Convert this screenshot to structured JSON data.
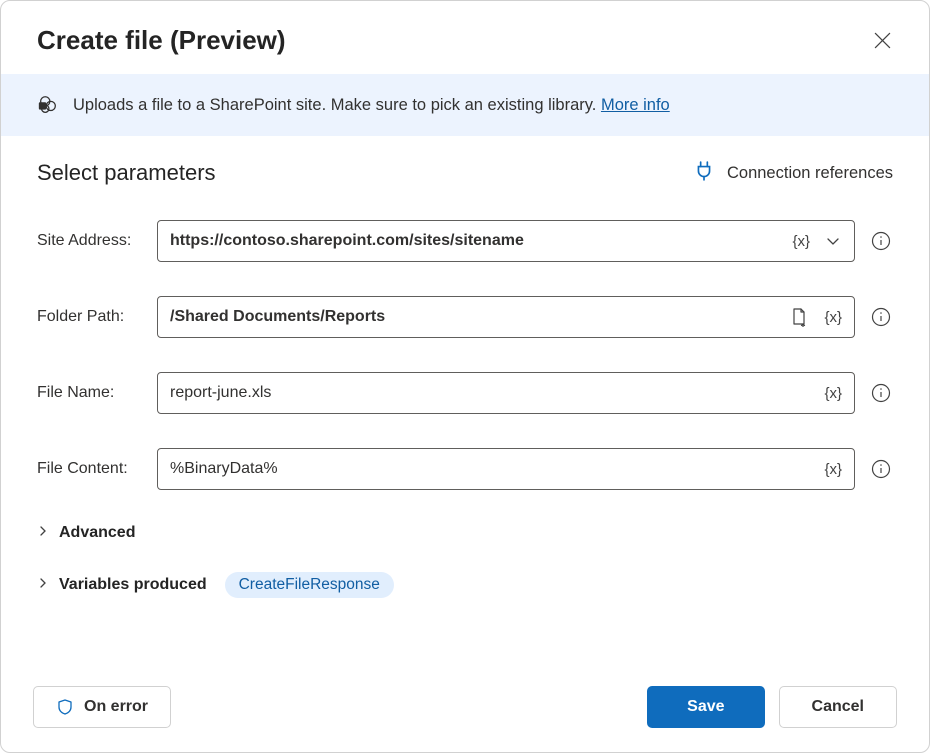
{
  "header": {
    "title": "Create file (Preview)"
  },
  "banner": {
    "text": "Uploads a file to a SharePoint site. Make sure to pick an existing library. ",
    "link_text": "More info"
  },
  "params": {
    "section_title": "Select parameters",
    "connection_references": "Connection references",
    "var_token": "{x}",
    "fields": {
      "site_address": {
        "label": "Site Address:",
        "value": "https://contoso.sharepoint.com/sites/sitename"
      },
      "folder_path": {
        "label": "Folder Path:",
        "value": "/Shared Documents/Reports"
      },
      "file_name": {
        "label": "File Name:",
        "value": "report-june.xls"
      },
      "file_content": {
        "label": "File Content:",
        "value": "%BinaryData%"
      }
    },
    "advanced_label": "Advanced",
    "variables_produced_label": "Variables produced",
    "variables_produced_chip": "CreateFileResponse"
  },
  "footer": {
    "on_error": "On error",
    "save": "Save",
    "cancel": "Cancel"
  }
}
